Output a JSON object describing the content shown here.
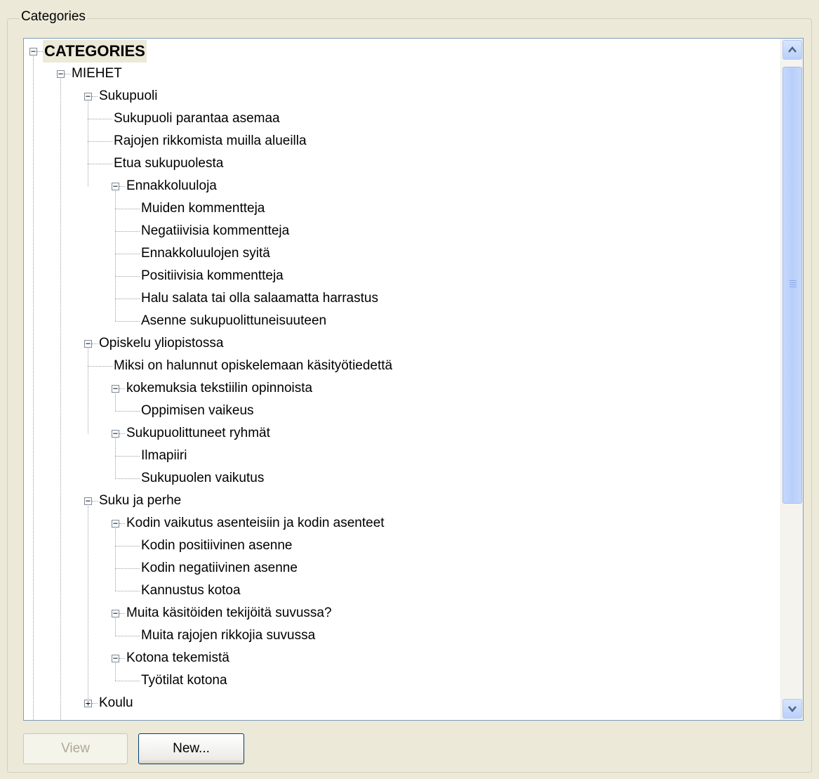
{
  "group": {
    "label": "Categories"
  },
  "tree": {
    "nodes": [
      {
        "label": "CATEGORIES",
        "level": 0,
        "toggle": "minus"
      },
      {
        "label": "MIEHET",
        "level": 1,
        "toggle": "minus"
      },
      {
        "label": "Sukupuoli",
        "level": 2,
        "toggle": "minus"
      },
      {
        "label": "Sukupuoli parantaa asemaa",
        "level": 3,
        "toggle": "none"
      },
      {
        "label": "Rajojen rikkomista muilla alueilla",
        "level": 3,
        "toggle": "none"
      },
      {
        "label": "Etua sukupuolesta",
        "level": 3,
        "toggle": "none"
      },
      {
        "label": "Ennakkoluuloja",
        "level": 3,
        "toggle": "minus"
      },
      {
        "label": "Muiden kommentteja",
        "level": 4,
        "toggle": "none"
      },
      {
        "label": "Negatiivisia kommentteja",
        "level": 4,
        "toggle": "none"
      },
      {
        "label": "Ennakkoluulojen syitä",
        "level": 4,
        "toggle": "none"
      },
      {
        "label": "Positiivisia kommentteja",
        "level": 4,
        "toggle": "none"
      },
      {
        "label": "Halu salata tai olla salaamatta harrastus",
        "level": 4,
        "toggle": "none"
      },
      {
        "label": "Asenne sukupuolittuneisuuteen",
        "level": 4,
        "toggle": "none"
      },
      {
        "label": "Opiskelu yliopistossa",
        "level": 2,
        "toggle": "minus"
      },
      {
        "label": "Miksi on halunnut opiskelemaan käsityötiedettä",
        "level": 3,
        "toggle": "none"
      },
      {
        "label": "kokemuksia tekstiilin opinnoista",
        "level": 3,
        "toggle": "minus"
      },
      {
        "label": "Oppimisen vaikeus",
        "level": 4,
        "toggle": "none"
      },
      {
        "label": "Sukupuolittuneet ryhmät",
        "level": 3,
        "toggle": "minus"
      },
      {
        "label": "Ilmapiiri",
        "level": 4,
        "toggle": "none"
      },
      {
        "label": "Sukupuolen vaikutus",
        "level": 4,
        "toggle": "none"
      },
      {
        "label": "Suku ja perhe",
        "level": 2,
        "toggle": "minus"
      },
      {
        "label": "Kodin vaikutus asenteisiin ja kodin asenteet",
        "level": 3,
        "toggle": "minus"
      },
      {
        "label": "Kodin positiivinen asenne",
        "level": 4,
        "toggle": "none"
      },
      {
        "label": "Kodin negatiivinen asenne",
        "level": 4,
        "toggle": "none"
      },
      {
        "label": "Kannustus kotoa",
        "level": 4,
        "toggle": "none"
      },
      {
        "label": "Muita käsitöiden tekijöitä suvussa?",
        "level": 3,
        "toggle": "minus"
      },
      {
        "label": "Muita rajojen rikkojia suvussa",
        "level": 4,
        "toggle": "none"
      },
      {
        "label": "Kotona tekemistä",
        "level": 3,
        "toggle": "minus"
      },
      {
        "label": "Työtilat kotona",
        "level": 4,
        "toggle": "none"
      },
      {
        "label": "Koulu",
        "level": 2,
        "toggle": "plus"
      }
    ]
  },
  "buttons": {
    "view": "View",
    "new": "New..."
  }
}
